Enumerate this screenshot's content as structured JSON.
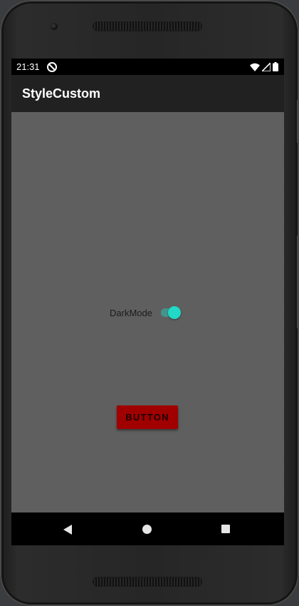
{
  "status_bar": {
    "time": "21:31",
    "app_icon": "do-not-disturb-icon",
    "icons": [
      "wifi-icon",
      "cellular-signal-icon",
      "battery-icon"
    ]
  },
  "app_bar": {
    "title": "StyleCustom"
  },
  "main": {
    "dark_mode_switch": {
      "label": "DarkMode",
      "checked": true
    },
    "button": {
      "label": "BUTTON"
    }
  },
  "nav_bar": {
    "icons": [
      "back-icon",
      "home-icon",
      "recents-icon"
    ]
  },
  "colors": {
    "content_background": "#5f5f5f",
    "app_bar": "#212121",
    "switch_accent": "#22d8c6",
    "button_background": "#a10000",
    "status_bar": "#000000"
  }
}
